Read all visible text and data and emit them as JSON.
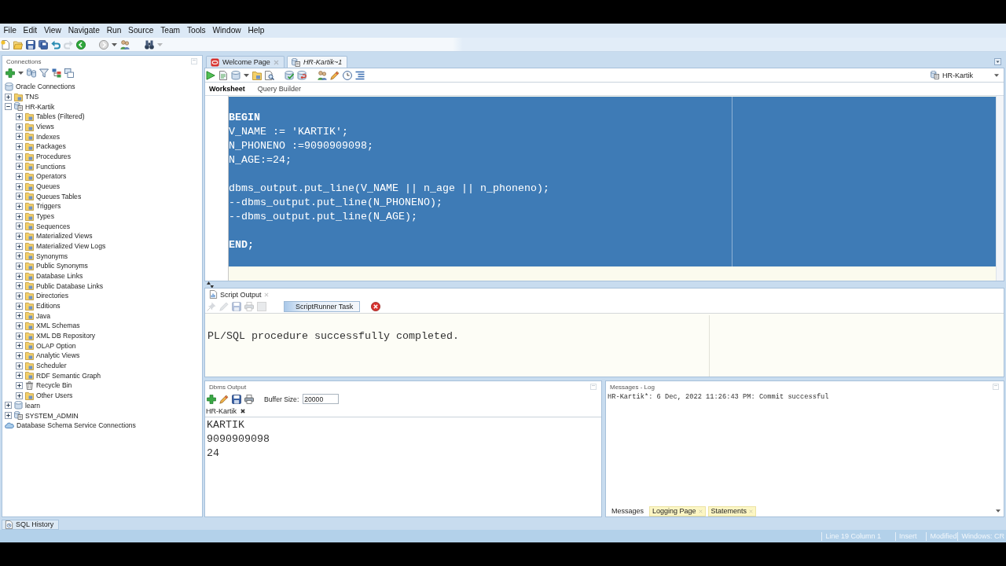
{
  "menu": [
    "File",
    "Edit",
    "View",
    "Navigate",
    "Run",
    "Source",
    "Team",
    "Tools",
    "Window",
    "Help"
  ],
  "connections": {
    "title": "Connections",
    "tree": [
      {
        "label": "Oracle Connections",
        "kind": "database",
        "children": [
          {
            "label": "TNS",
            "kind": "folder",
            "expanded": false
          },
          {
            "label": "HR-Kartik",
            "kind": "connection",
            "expanded": true,
            "children": [
              {
                "label": "Tables (Filtered)",
                "kind": "folder",
                "expanded": false
              },
              {
                "label": "Views",
                "kind": "folder",
                "expanded": false
              },
              {
                "label": "Indexes",
                "kind": "folder",
                "expanded": false
              },
              {
                "label": "Packages",
                "kind": "folder",
                "expanded": false
              },
              {
                "label": "Procedures",
                "kind": "folder",
                "expanded": false
              },
              {
                "label": "Functions",
                "kind": "folder",
                "expanded": false
              },
              {
                "label": "Operators",
                "kind": "folder",
                "expanded": false
              },
              {
                "label": "Queues",
                "kind": "folder",
                "expanded": false
              },
              {
                "label": "Queues Tables",
                "kind": "folder",
                "expanded": false
              },
              {
                "label": "Triggers",
                "kind": "folder",
                "expanded": false
              },
              {
                "label": "Types",
                "kind": "folder",
                "expanded": false
              },
              {
                "label": "Sequences",
                "kind": "folder",
                "expanded": false
              },
              {
                "label": "Materialized Views",
                "kind": "folder",
                "expanded": false
              },
              {
                "label": "Materialized View Logs",
                "kind": "folder",
                "expanded": false
              },
              {
                "label": "Synonyms",
                "kind": "folder",
                "expanded": false
              },
              {
                "label": "Public Synonyms",
                "kind": "folder",
                "expanded": false
              },
              {
                "label": "Database Links",
                "kind": "folder",
                "expanded": false
              },
              {
                "label": "Public Database Links",
                "kind": "folder",
                "expanded": false
              },
              {
                "label": "Directories",
                "kind": "folder",
                "expanded": false
              },
              {
                "label": "Editions",
                "kind": "folder",
                "expanded": false
              },
              {
                "label": "Java",
                "kind": "folder",
                "expanded": false
              },
              {
                "label": "XML Schemas",
                "kind": "folder",
                "expanded": false
              },
              {
                "label": "XML DB Repository",
                "kind": "folder",
                "expanded": false
              },
              {
                "label": "OLAP Option",
                "kind": "folder",
                "expanded": false
              },
              {
                "label": "Analytic Views",
                "kind": "folder",
                "expanded": false
              },
              {
                "label": "Scheduler",
                "kind": "folder",
                "expanded": false
              },
              {
                "label": "RDF Semantic Graph",
                "kind": "folder",
                "expanded": false
              },
              {
                "label": "Recycle Bin",
                "kind": "bin",
                "expanded": false
              },
              {
                "label": "Other Users",
                "kind": "folder",
                "expanded": false
              }
            ]
          },
          {
            "label": "learn",
            "kind": "database",
            "expanded": false
          },
          {
            "label": "SYSTEM_ADMIN",
            "kind": "connection",
            "expanded": false
          }
        ]
      },
      {
        "label": "Database Schema Service Connections",
        "kind": "cloud"
      }
    ]
  },
  "editor": {
    "tabs": [
      {
        "label": "Welcome Page",
        "selected": false,
        "closable": true,
        "modified": false
      },
      {
        "label": "HR-Kartik~1",
        "selected": true,
        "closable": false,
        "modified": true
      }
    ],
    "connection": "HR-Kartik",
    "subtabs": [
      {
        "label": "Worksheet",
        "selected": true
      },
      {
        "label": "Query Builder",
        "selected": false
      }
    ],
    "selected": true,
    "code": [
      {
        "kind": "blank"
      },
      {
        "kind": "keyword",
        "text": "BEGIN"
      },
      {
        "kind": "code",
        "text": "V_NAME := 'KARTIK';"
      },
      {
        "kind": "code",
        "text": "N_PHONENO :=9090909098;"
      },
      {
        "kind": "code",
        "text": "N_AGE:=24;"
      },
      {
        "kind": "blank"
      },
      {
        "kind": "code",
        "text": "dbms_output.put_line(V_NAME || n_age || n_phoneno);"
      },
      {
        "kind": "code",
        "text": "--dbms_output.put_line(N_PHONENO);"
      },
      {
        "kind": "code",
        "text": "--dbms_output.put_line(N_AGE);"
      },
      {
        "kind": "blank"
      },
      {
        "kind": "keyword",
        "text": "END;"
      },
      {
        "kind": "blank"
      }
    ]
  },
  "script_output": {
    "tab": "Script Output",
    "task": "ScriptRunner Task",
    "lines": [
      "PL/SQL procedure successfully completed."
    ]
  },
  "dbms_output": {
    "title": "Dbms Output",
    "buffer_label": "Buffer Size:",
    "buffer_size": "20000",
    "tab": "HR-Kartik",
    "lines": [
      "KARTIK",
      "9090909098",
      "24"
    ]
  },
  "messages_log": {
    "title": "Messages - Log",
    "lines": [
      "HR-Kartik*: 6 Dec, 2022 11:26:43 PM: Commit successful"
    ],
    "tabs": [
      {
        "label": "Messages",
        "selected": true,
        "closable": false
      },
      {
        "label": "Logging Page",
        "selected": false,
        "closable": true
      },
      {
        "label": "Statements",
        "selected": false,
        "closable": true
      }
    ]
  },
  "sql_history": "SQL History",
  "status_bar": [
    "Line 19 Column 1",
    "Insert",
    "Modified",
    "Windows: CR"
  ]
}
